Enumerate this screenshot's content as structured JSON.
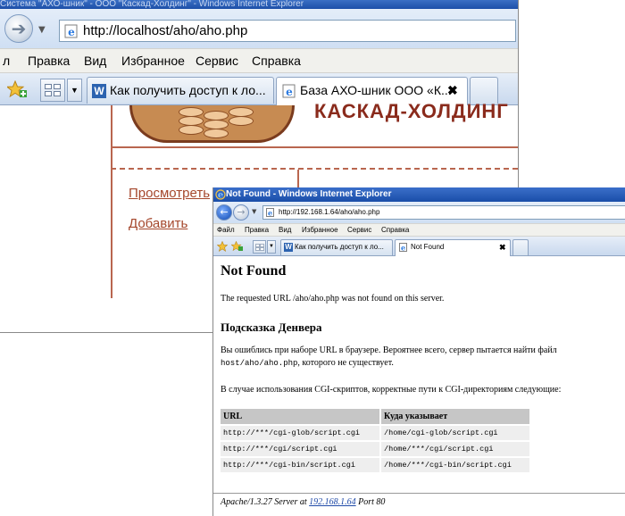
{
  "bg_window": {
    "title": "Система \"АХО-шник\" - ООО \"Каскад-Холдинг\" - Windows Internet Explorer",
    "address": "http://localhost/aho/aho.php",
    "menu": [
      "л",
      "Правка",
      "Вид",
      "Избранное",
      "Сервис",
      "Справка"
    ],
    "tabs": [
      {
        "label": "Как получить доступ к ло..."
      },
      {
        "label": "База АХО-шник ООО «К...",
        "close": "✖"
      }
    ],
    "company": "КАСКАД-ХОЛДИНГ",
    "links": [
      "Просмотреть",
      "Добавить"
    ]
  },
  "fg_window": {
    "title": "Not Found - Windows Internet Explorer",
    "address": "http://192.168.1.64/aho/aho.php",
    "menu": [
      "Файл",
      "Правка",
      "Вид",
      "Избранное",
      "Сервис",
      "Справка"
    ],
    "tabs": [
      {
        "label": "Как получить доступ к ло..."
      },
      {
        "label": "Not Found",
        "close": "✖"
      }
    ],
    "page": {
      "heading": "Not Found",
      "message": "The requested URL /aho/aho.php was not found on this server.",
      "subheading": "Подсказка Денвера",
      "hint_line1": "Вы ошиблись при наборе URL в браузере. Вероятнее всего, сервер пытается найти файл",
      "hint_path": "host/aho/aho.php",
      "hint_line2_suffix": ", которого не существует.",
      "cgi_text": "В случае использования CGI-скриптов, корректные пути к CGI-директориям следующие:",
      "table": {
        "headers": [
          "URL",
          "Куда указывает"
        ],
        "rows": [
          [
            "http://***/cgi-glob/script.cgi",
            "/home/cgi-glob/script.cgi"
          ],
          [
            "http://***/cgi/script.cgi",
            "/home/***/cgi/script.cgi"
          ],
          [
            "http://***/cgi-bin/script.cgi",
            "/home/***/cgi-bin/script.cgi"
          ]
        ]
      },
      "footer": {
        "server_prefix": "Apache/1.3.27 Server at ",
        "host": "192.168.1.64",
        "port_suffix": " Port 80"
      }
    }
  },
  "icons": [
    "back-arrow-icon",
    "forward-arrow-icon",
    "ie-page-icon",
    "favorites-star-icon",
    "add-favorites-icon",
    "quick-tabs-icon",
    "tab-list-icon",
    "tab-close-icon"
  ],
  "colors": {
    "title_bar": "#1c4fa8",
    "accent_brown": "#a5472c",
    "link_blue": "#1f4aa8"
  }
}
